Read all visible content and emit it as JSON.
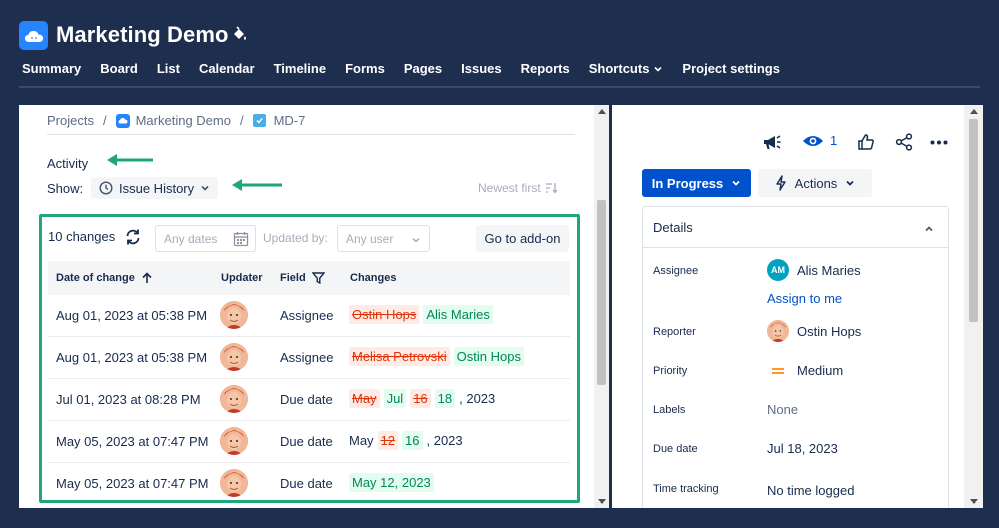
{
  "project": {
    "title": "Marketing Demo"
  },
  "nav": [
    {
      "label": "Summary"
    },
    {
      "label": "Board"
    },
    {
      "label": "List"
    },
    {
      "label": "Calendar"
    },
    {
      "label": "Timeline"
    },
    {
      "label": "Forms"
    },
    {
      "label": "Pages"
    },
    {
      "label": "Issues"
    },
    {
      "label": "Reports"
    },
    {
      "label": "Shortcuts"
    },
    {
      "label": "Project settings"
    }
  ],
  "breadcrumb": {
    "projects": "Projects",
    "project": "Marketing Demo",
    "issue": "MD-7"
  },
  "activity": {
    "label": "Activity",
    "show_label": "Show:",
    "filter_value": "Issue History",
    "sort_label": "Newest first"
  },
  "history": {
    "count_label": "10 changes",
    "dates_placeholder": "Any dates",
    "updated_by_label": "Updated by:",
    "user_placeholder": "Any user",
    "goto_label": "Go to add-on",
    "columns": {
      "date": "Date of change",
      "updater": "Updater",
      "field": "Field",
      "changes": "Changes"
    },
    "rows": [
      {
        "date": "Aug 01, 2023 at 05:38 PM",
        "field": "Assignee",
        "changes": [
          {
            "t": "Ostin Hops",
            "k": "del"
          },
          {
            "t": "Alis Maries",
            "k": "ins"
          }
        ]
      },
      {
        "date": "Aug 01, 2023 at 05:38 PM",
        "field": "Assignee",
        "changes": [
          {
            "t": "Melisa Petrovski",
            "k": "del"
          },
          {
            "t": "Ostin Hops",
            "k": "ins"
          }
        ]
      },
      {
        "date": "Jul 01, 2023 at 08:28 PM",
        "field": "Due date",
        "changes": [
          {
            "t": "May",
            "k": "del"
          },
          {
            "t": "Jul",
            "k": "ins"
          },
          {
            "t": "16",
            "k": "del"
          },
          {
            "t": "18",
            "k": "ins"
          },
          {
            "t": ", 2023",
            "k": "plain"
          }
        ]
      },
      {
        "date": "May 05, 2023 at 07:47 PM",
        "field": "Due date",
        "changes": [
          {
            "t": "May",
            "k": "plain"
          },
          {
            "t": "12",
            "k": "del"
          },
          {
            "t": "16",
            "k": "ins"
          },
          {
            "t": ", 2023",
            "k": "plain"
          }
        ]
      },
      {
        "date": "May 05, 2023 at 07:47 PM",
        "field": "Due date",
        "changes": [
          {
            "t": "May 12, 2023",
            "k": "ins"
          }
        ]
      }
    ]
  },
  "issue_actions": {
    "watchers": "1"
  },
  "status": {
    "label": "In Progress"
  },
  "actions": {
    "label": "Actions"
  },
  "details": {
    "title": "Details",
    "assignee_label": "Assignee",
    "assignee_initials": "AM",
    "assignee": "Alis Maries",
    "assign_me": "Assign to me",
    "reporter_label": "Reporter",
    "reporter": "Ostin Hops",
    "priority_label": "Priority",
    "priority": "Medium",
    "labels_label": "Labels",
    "labels": "None",
    "due_label": "Due date",
    "due": "Jul 18, 2023",
    "time_label": "Time tracking",
    "time": "No time logged"
  },
  "colors": {
    "accent_green": "#1fa67a",
    "status_blue": "#0052cc",
    "header_bg": "#1d2e4f"
  }
}
